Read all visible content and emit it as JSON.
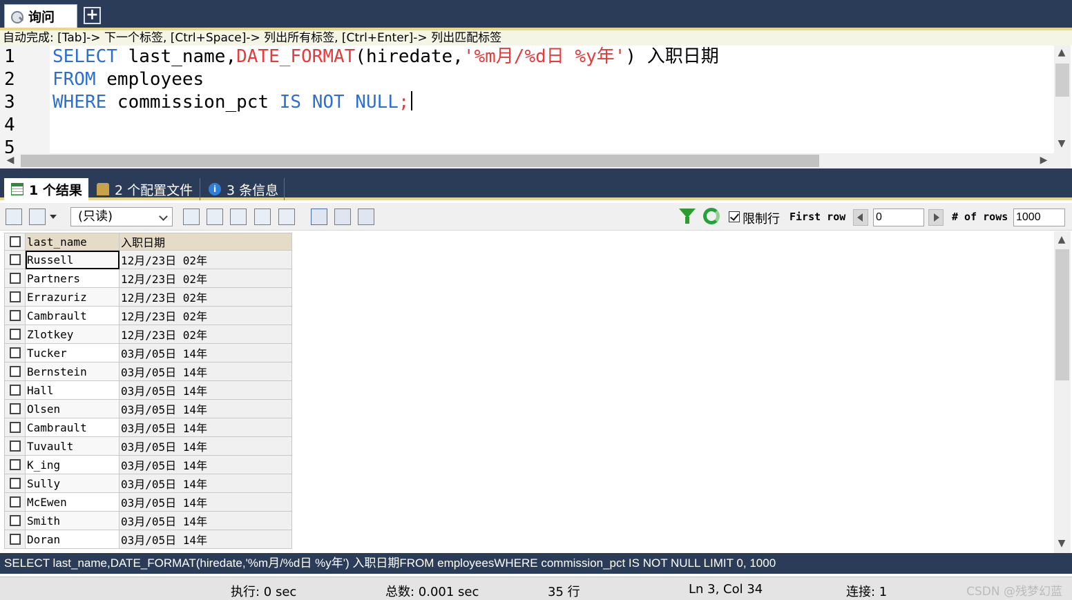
{
  "query_tab": {
    "label": "询问",
    "add_label": "+"
  },
  "hint": "自动完成:  [Tab]-> 下一个标签,  [Ctrl+Space]-> 列出所有标签,  [Ctrl+Enter]-> 列出匹配标签",
  "editor": {
    "line_numbers": [
      "1",
      "2",
      "3",
      "4",
      "5"
    ],
    "lines": [
      {
        "kw1": "SELECT",
        "t1": " last_name,",
        "fn": "DATE_FORMAT",
        "t2": "(hiredate,",
        "str": "'%m月/%d日 %y年'",
        "t3": ") 入职日期"
      },
      {
        "kw1": "FROM",
        "t1": " employees"
      },
      {
        "kw1": "WHERE",
        "t1": " commission_pct ",
        "kw2": "IS NOT NULL",
        "t3": ";"
      }
    ]
  },
  "result_tabs": [
    {
      "label": "1 个结果",
      "icon": "grid-icon"
    },
    {
      "label": "2 个配置文件",
      "icon": "profile-icon"
    },
    {
      "label": "3 条信息",
      "icon": "info-icon"
    }
  ],
  "toolbar": {
    "mode": "(只读)",
    "limit_label": "限制行",
    "first_row_label": "First row",
    "first_row_value": "0",
    "num_rows_label": "# of rows",
    "num_rows_value": "1000"
  },
  "grid": {
    "columns": [
      "last_name",
      "入职日期"
    ],
    "rows": [
      [
        "Russell",
        "12月/23日 02年"
      ],
      [
        "Partners",
        "12月/23日 02年"
      ],
      [
        "Errazuriz",
        "12月/23日 02年"
      ],
      [
        "Cambrault",
        "12月/23日 02年"
      ],
      [
        "Zlotkey",
        "12月/23日 02年"
      ],
      [
        "Tucker",
        "03月/05日 14年"
      ],
      [
        "Bernstein",
        "03月/05日 14年"
      ],
      [
        "Hall",
        "03月/05日 14年"
      ],
      [
        "Olsen",
        "03月/05日 14年"
      ],
      [
        "Cambrault",
        "03月/05日 14年"
      ],
      [
        "Tuvault",
        "03月/05日 14年"
      ],
      [
        "K_ing",
        "03月/05日 14年"
      ],
      [
        "Sully",
        "03月/05日 14年"
      ],
      [
        "McEwen",
        "03月/05日 14年"
      ],
      [
        "Smith",
        "03月/05日 14年"
      ],
      [
        "Doran",
        "03月/05日 14年"
      ]
    ]
  },
  "sql_status": "SELECT last_name,DATE_FORMAT(hiredate,'%m月/%d日 %y年') 入职日期FROM employeesWHERE commission_pct IS NOT NULL LIMIT 0, 1000",
  "status": {
    "exec": "执行: 0 sec",
    "total": "总数: 0.001 sec",
    "rows": "35 行",
    "position": "Ln 3, Col 34",
    "connections": "连接: 1",
    "watermark": "CSDN @残梦幻蓝"
  }
}
